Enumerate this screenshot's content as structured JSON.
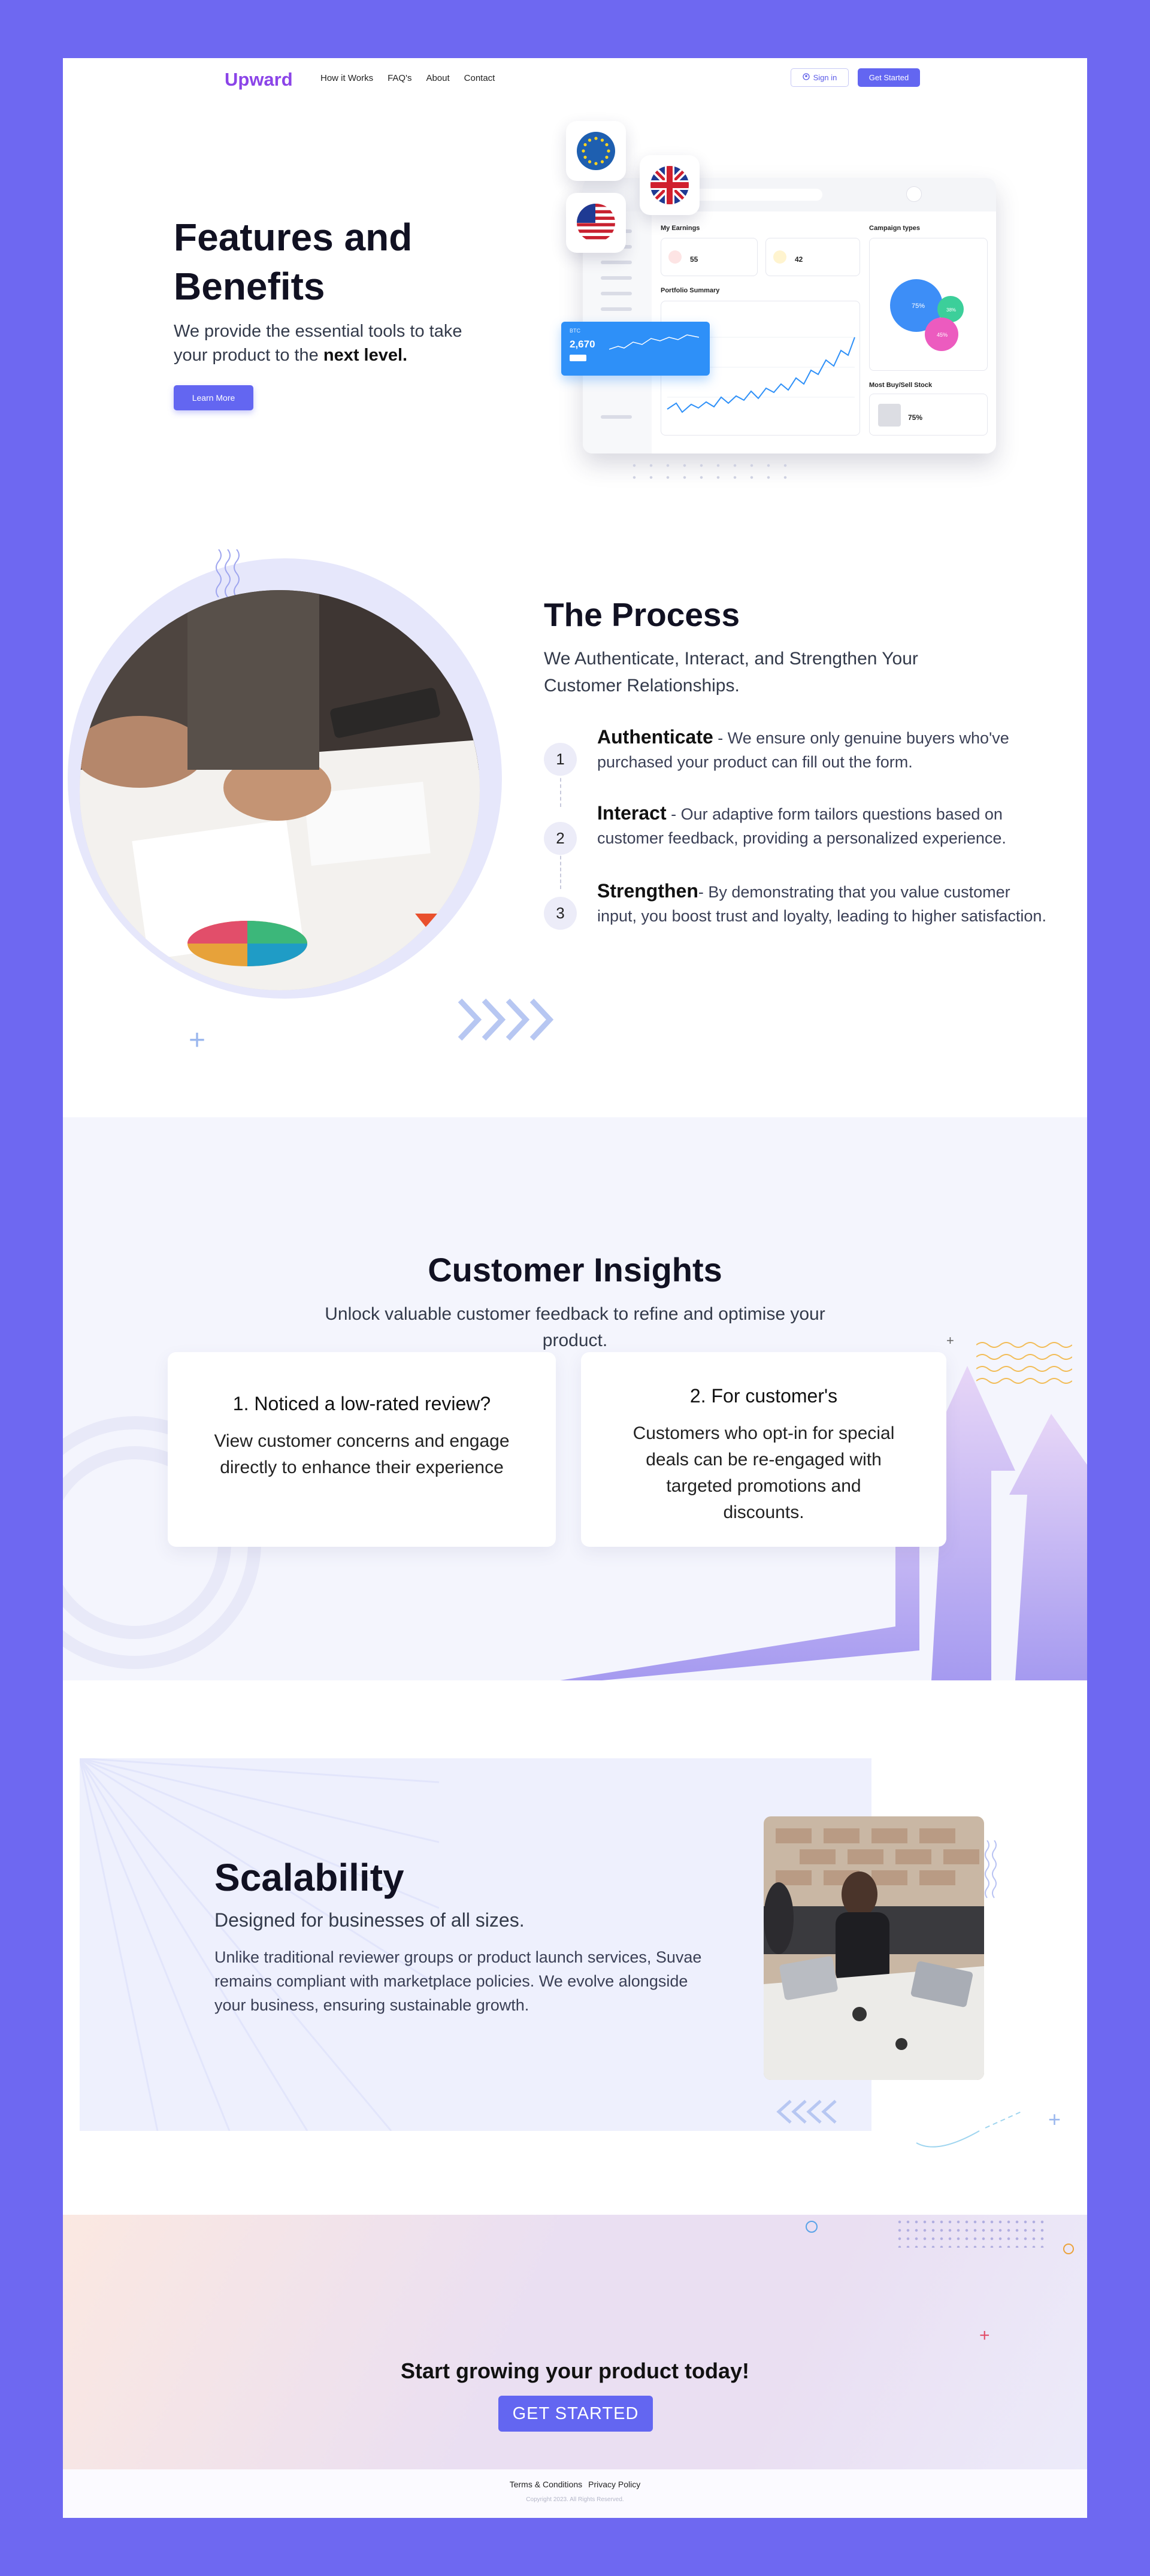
{
  "nav": {
    "logo": "Upward",
    "links": [
      "How it Works",
      "FAQ's",
      "About",
      "Contact"
    ],
    "signin": "Sign in",
    "get_started": "Get Started"
  },
  "hero": {
    "title": "Features and Benefits",
    "subtitle_prefix": "We provide the essential tools to take your product to the ",
    "subtitle_bold": "next level.",
    "learn_more": "Learn More"
  },
  "dashboard": {
    "my_earnings": "My Earnings",
    "earn_value_1": "55",
    "earn_value_2": "42",
    "portfolio": "Portfolio Summary",
    "campaign": "Campaign types",
    "pie_values": [
      "75%",
      "38%",
      "45%"
    ],
    "stock": "Most Buy/Sell Stock",
    "stock_value": "75%",
    "tip_label": "BTC",
    "tip_value": "2,670"
  },
  "process": {
    "title": "The Process",
    "subtitle": "We Authenticate, Interact, and Strengthen Your Customer Relationships.",
    "steps": [
      {
        "num": "1",
        "title": "Authenticate",
        "text": " - We ensure only genuine buyers who've purchased your product can fill out the form."
      },
      {
        "num": "2",
        "title": "Interact",
        "text": " - Our adaptive form tailors questions based on customer feedback, providing a personalized experience."
      },
      {
        "num": "3",
        "title": "Strengthen",
        "text": "- By demonstrating that you value customer input, you boost trust and loyalty, leading to higher satisfaction."
      }
    ]
  },
  "insights": {
    "title": "Customer Insights",
    "subtitle": "Unlock valuable customer feedback to refine and optimise your product.",
    "cards": [
      {
        "title": "1. Noticed a low-rated review?",
        "text": "View customer concerns and engage directly to enhance their experience"
      },
      {
        "title": "2. For customer's",
        "text": "Customers who opt-in for special deals can be re-engaged with targeted promotions and discounts."
      }
    ]
  },
  "scalability": {
    "title": "Scalability",
    "subtitle": "Designed for businesses of all sizes.",
    "body": "Unlike traditional reviewer groups or product launch services, Suvae remains compliant with marketplace policies. We evolve alongside your business, ensuring sustainable growth."
  },
  "cta": {
    "title": "Start growing your product today!",
    "button": "GET STARTED"
  },
  "footer": {
    "terms": "Terms & Conditions",
    "privacy": "Privacy Policy",
    "copyright": "Copyright 2023. All Rights Reserved."
  },
  "colors": {
    "frame": "#6e68f1",
    "accent": "#6366f1",
    "logo": "#8b44e8"
  }
}
